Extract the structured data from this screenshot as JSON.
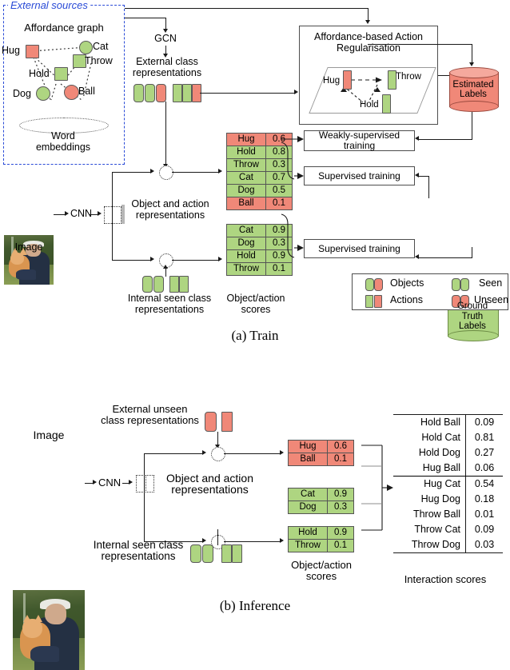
{
  "figure": {
    "caption_a": "(a) Train",
    "caption_b": "(b) Inference"
  },
  "train": {
    "external_sources": {
      "panel_title": "External sources",
      "affordance_graph_title": "Affordance graph",
      "nodes": [
        {
          "label": "Hug",
          "kind": "action",
          "seen": false
        },
        {
          "label": "Cat",
          "kind": "object",
          "seen": true
        },
        {
          "label": "Throw",
          "kind": "action",
          "seen": true
        },
        {
          "label": "Hold",
          "kind": "action",
          "seen": true
        },
        {
          "label": "Dog",
          "kind": "object",
          "seen": true
        },
        {
          "label": "Ball",
          "kind": "object",
          "seen": false
        }
      ],
      "word_embeddings_label": "Word embeddings"
    },
    "gcn_label": "GCN",
    "external_class_rep_label": "External class representations",
    "external_class_rep_glyphs": {
      "objects": [
        "seen",
        "seen",
        "unseen"
      ],
      "actions": [
        "seen",
        "seen",
        "unseen"
      ]
    },
    "regularisation": {
      "title": "Affordance-based Action Regularisation",
      "nodes": [
        {
          "label": "Hug",
          "seen": false
        },
        {
          "label": "Throw",
          "seen": true
        },
        {
          "label": "Hold",
          "seen": true
        }
      ]
    },
    "estimated_labels": {
      "text": "Estimated Labels",
      "color": "#f08878"
    },
    "ground_truth_labels": {
      "text": "Ground Truth Labels",
      "color": "#aed581"
    },
    "image_label": "Image",
    "cnn_label": "CNN",
    "object_action_rep_label": "Object and action representations",
    "internal_seen_rep_label": "Internal seen class representations",
    "object_action_scores_label": "Object/action scores",
    "weakly_supervised_label": "Weakly-supervised training",
    "supervised_label_1": "Supervised training",
    "supervised_label_2": "Supervised training",
    "scores_top": [
      {
        "label": "Hug",
        "value": "0.6",
        "seen": false
      },
      {
        "label": "Hold",
        "value": "0.8",
        "seen": true
      },
      {
        "label": "Throw",
        "value": "0.3",
        "seen": true
      },
      {
        "label": "Cat",
        "value": "0.7",
        "seen": true
      },
      {
        "label": "Dog",
        "value": "0.5",
        "seen": true
      },
      {
        "label": "Ball",
        "value": "0.1",
        "seen": false
      }
    ],
    "scores_bottom": [
      {
        "label": "Cat",
        "value": "0.9",
        "seen": true
      },
      {
        "label": "Dog",
        "value": "0.3",
        "seen": true
      },
      {
        "label": "Hold",
        "value": "0.9",
        "seen": true
      },
      {
        "label": "Throw",
        "value": "0.1",
        "seen": true
      }
    ],
    "legend": {
      "objects_label": "Objects",
      "actions_label": "Actions",
      "seen_label": "Seen",
      "unseen_label": "Unseen"
    }
  },
  "inference": {
    "image_label": "Image",
    "cnn_label": "CNN",
    "external_unseen_rep_label": "External unseen class representations",
    "internal_seen_rep_label": "Internal seen class representations",
    "object_action_rep_label": "Object and action representations",
    "object_action_scores_label": "Object/action scores",
    "interaction_scores_label": "Interaction scores",
    "scores_unseen": [
      {
        "label": "Hug",
        "value": "0.6",
        "seen": false
      },
      {
        "label": "Ball",
        "value": "0.1",
        "seen": false
      }
    ],
    "scores_seen_objects": [
      {
        "label": "Cat",
        "value": "0.9",
        "seen": true
      },
      {
        "label": "Dog",
        "value": "0.3",
        "seen": true
      }
    ],
    "scores_seen_actions": [
      {
        "label": "Hold",
        "value": "0.9",
        "seen": true
      },
      {
        "label": "Throw",
        "value": "0.1",
        "seen": true
      }
    ],
    "interaction_scores": [
      {
        "label": "Hold Ball",
        "value": "0.09"
      },
      {
        "label": "Hold Cat",
        "value": "0.81"
      },
      {
        "label": "Hold Dog",
        "value": "0.27"
      },
      {
        "label": "Hug Ball",
        "value": "0.06"
      },
      {
        "label": "Hug Cat",
        "value": "0.54"
      },
      {
        "label": "Hug Dog",
        "value": "0.18"
      },
      {
        "label": "Throw Ball",
        "value": "0.01"
      },
      {
        "label": "Throw Cat",
        "value": "0.09"
      },
      {
        "label": "Throw Dog",
        "value": "0.03"
      }
    ]
  },
  "colors": {
    "seen": "#aed581",
    "unseen": "#f08878",
    "panel_border": "#2a4bd7"
  }
}
